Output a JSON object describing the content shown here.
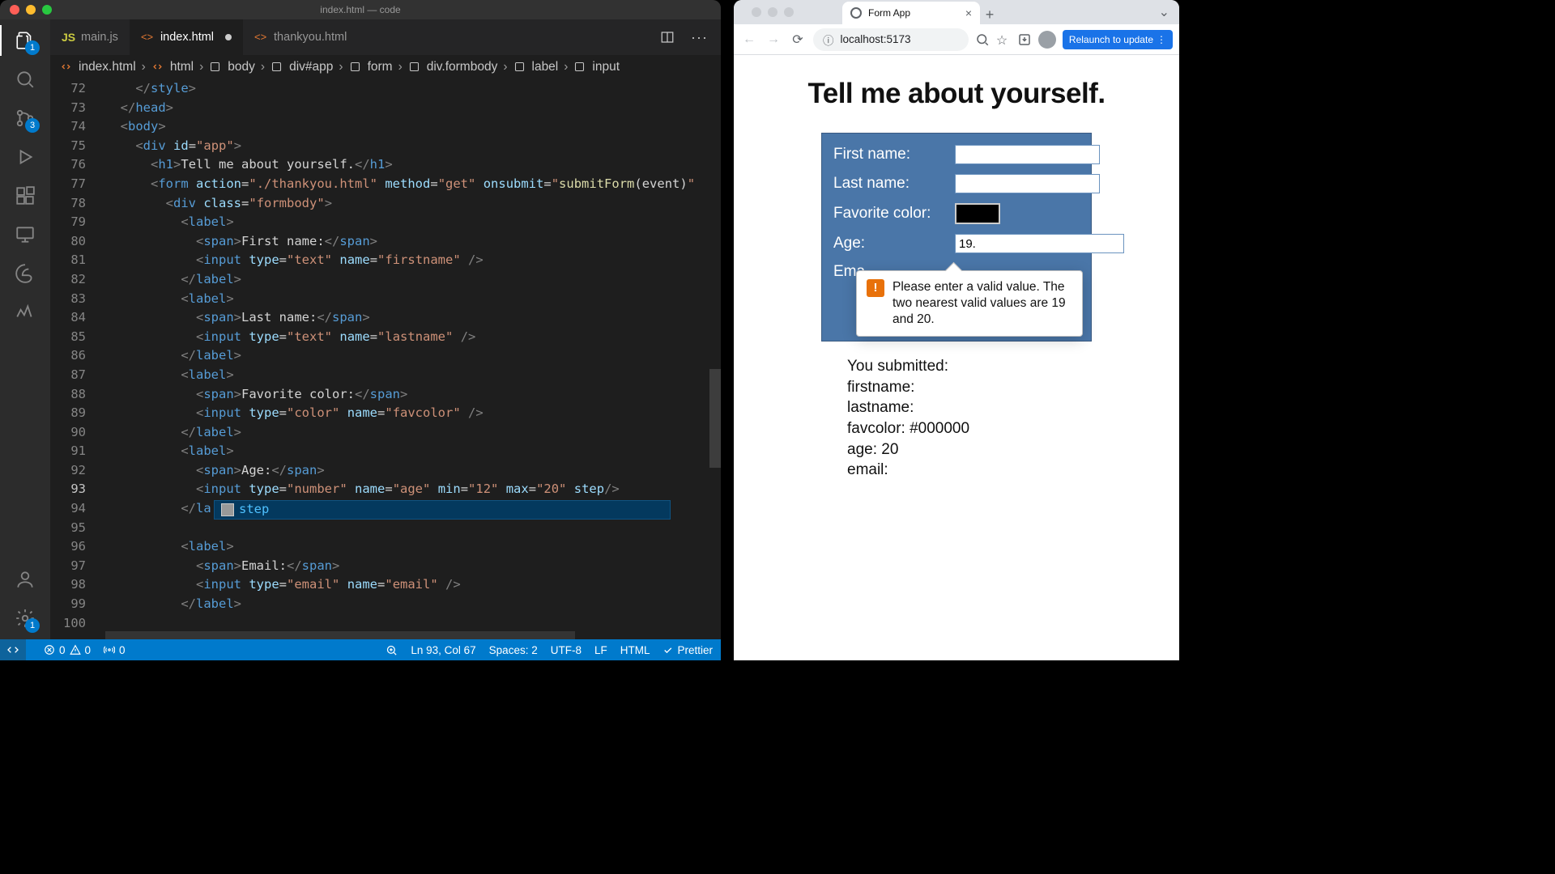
{
  "vscode": {
    "title": "index.html — code",
    "tabs": [
      {
        "label": "main.js"
      },
      {
        "label": "index.html",
        "active": true,
        "modified": true
      },
      {
        "label": "thankyou.html"
      }
    ],
    "breadcrumb": [
      "index.html",
      "html",
      "body",
      "div#app",
      "form",
      "div.formbody",
      "label",
      "input"
    ],
    "activity_badges": {
      "explorer": "1",
      "scm": "3",
      "settings": "1"
    },
    "autocomplete": {
      "text": "step"
    },
    "status": {
      "errors": "0",
      "warnings": "0",
      "ports": "0",
      "cursor": "Ln 93, Col 67",
      "spaces": "Spaces: 2",
      "encoding": "UTF-8",
      "eol": "LF",
      "language": "HTML",
      "formatter": "Prettier"
    },
    "code_lines": [
      {
        "n": 72,
        "html": "    <span class='s-brkt'>&lt;/</span><span class='s-tag'>style</span><span class='s-brkt'>&gt;</span>"
      },
      {
        "n": 73,
        "html": "  <span class='s-brkt'>&lt;/</span><span class='s-tag'>head</span><span class='s-brkt'>&gt;</span>"
      },
      {
        "n": 74,
        "html": "  <span class='s-brkt'>&lt;</span><span class='s-tag'>body</span><span class='s-brkt'>&gt;</span>"
      },
      {
        "n": 75,
        "html": "    <span class='s-brkt'>&lt;</span><span class='s-tag'>div</span> <span class='s-attr'>id</span>=<span class='s-str'>\"app\"</span><span class='s-brkt'>&gt;</span>"
      },
      {
        "n": 76,
        "html": "      <span class='s-brkt'>&lt;</span><span class='s-tag'>h1</span><span class='s-brkt'>&gt;</span>Tell me about yourself.<span class='s-brkt'>&lt;/</span><span class='s-tag'>h1</span><span class='s-brkt'>&gt;</span>"
      },
      {
        "n": 77,
        "html": "      <span class='s-brkt'>&lt;</span><span class='s-tag'>form</span> <span class='s-attr'>action</span>=<span class='s-str'>\"./thankyou.html\"</span> <span class='s-attr'>method</span>=<span class='s-str'>\"get\"</span> <span class='s-attr'>onsubmit</span>=<span class='s-str'>\"</span><span class='s-meth'>submitForm</span>(event)<span class='s-str'>\"</span>"
      },
      {
        "n": 78,
        "html": "        <span class='s-brkt'>&lt;</span><span class='s-tag'>div</span> <span class='s-attr'>class</span>=<span class='s-str'>\"formbody\"</span><span class='s-brkt'>&gt;</span>"
      },
      {
        "n": 79,
        "html": "          <span class='s-brkt'>&lt;</span><span class='s-tag'>label</span><span class='s-brkt'>&gt;</span>"
      },
      {
        "n": 80,
        "html": "            <span class='s-brkt'>&lt;</span><span class='s-tag'>span</span><span class='s-brkt'>&gt;</span>First name:<span class='s-brkt'>&lt;/</span><span class='s-tag'>span</span><span class='s-brkt'>&gt;</span>"
      },
      {
        "n": 81,
        "html": "            <span class='s-brkt'>&lt;</span><span class='s-tag'>input</span> <span class='s-attr'>type</span>=<span class='s-str'>\"text\"</span> <span class='s-attr'>name</span>=<span class='s-str'>\"firstname\"</span> <span class='s-brkt'>/&gt;</span>"
      },
      {
        "n": 82,
        "html": "          <span class='s-brkt'>&lt;/</span><span class='s-tag'>label</span><span class='s-brkt'>&gt;</span>"
      },
      {
        "n": 83,
        "html": "          <span class='s-brkt'>&lt;</span><span class='s-tag'>label</span><span class='s-brkt'>&gt;</span>"
      },
      {
        "n": 84,
        "html": "            <span class='s-brkt'>&lt;</span><span class='s-tag'>span</span><span class='s-brkt'>&gt;</span>Last name:<span class='s-brkt'>&lt;/</span><span class='s-tag'>span</span><span class='s-brkt'>&gt;</span>"
      },
      {
        "n": 85,
        "html": "            <span class='s-brkt'>&lt;</span><span class='s-tag'>input</span> <span class='s-attr'>type</span>=<span class='s-str'>\"text\"</span> <span class='s-attr'>name</span>=<span class='s-str'>\"lastname\"</span> <span class='s-brkt'>/&gt;</span>"
      },
      {
        "n": 86,
        "html": "          <span class='s-brkt'>&lt;/</span><span class='s-tag'>label</span><span class='s-brkt'>&gt;</span>"
      },
      {
        "n": 87,
        "html": "          <span class='s-brkt'>&lt;</span><span class='s-tag'>label</span><span class='s-brkt'>&gt;</span>"
      },
      {
        "n": 88,
        "html": "            <span class='s-brkt'>&lt;</span><span class='s-tag'>span</span><span class='s-brkt'>&gt;</span>Favorite color:<span class='s-brkt'>&lt;/</span><span class='s-tag'>span</span><span class='s-brkt'>&gt;</span>"
      },
      {
        "n": 89,
        "html": "            <span class='s-brkt'>&lt;</span><span class='s-tag'>input</span> <span class='s-attr'>type</span>=<span class='s-str'>\"color\"</span> <span class='s-attr'>name</span>=<span class='s-str'>\"favcolor\"</span> <span class='s-brkt'>/&gt;</span>"
      },
      {
        "n": 90,
        "html": "          <span class='s-brkt'>&lt;/</span><span class='s-tag'>label</span><span class='s-brkt'>&gt;</span>"
      },
      {
        "n": 91,
        "html": "          <span class='s-brkt'>&lt;</span><span class='s-tag'>label</span><span class='s-brkt'>&gt;</span>"
      },
      {
        "n": 92,
        "html": "            <span class='s-brkt'>&lt;</span><span class='s-tag'>span</span><span class='s-brkt'>&gt;</span>Age:<span class='s-brkt'>&lt;/</span><span class='s-tag'>span</span><span class='s-brkt'>&gt;</span>"
      },
      {
        "n": 93,
        "cur": true,
        "html": "            <span class='s-brkt'>&lt;</span><span class='s-tag'>input</span> <span class='s-attr'>type</span>=<span class='s-str'>\"number\"</span> <span class='s-attr'>name</span>=<span class='s-str'>\"age\"</span> <span class='s-attr'>min</span>=<span class='s-str'>\"12\"</span> <span class='s-attr'>max</span>=<span class='s-str'>\"20\"</span> <span class='s-attr'>step</span><span class='s-brkt'>/&gt;</span>"
      },
      {
        "n": 94,
        "html": "          <span class='s-brkt'>&lt;/</span><span class='s-tag'>la</span>"
      },
      {
        "n": 95,
        "html": ""
      },
      {
        "n": 96,
        "html": "          <span class='s-brkt'>&lt;</span><span class='s-tag'>label</span><span class='s-brkt'>&gt;</span>"
      },
      {
        "n": 97,
        "html": "            <span class='s-brkt'>&lt;</span><span class='s-tag'>span</span><span class='s-brkt'>&gt;</span>Email:<span class='s-brkt'>&lt;/</span><span class='s-tag'>span</span><span class='s-brkt'>&gt;</span>"
      },
      {
        "n": 98,
        "html": "            <span class='s-brkt'>&lt;</span><span class='s-tag'>input</span> <span class='s-attr'>type</span>=<span class='s-str'>\"email\"</span> <span class='s-attr'>name</span>=<span class='s-str'>\"email\"</span> <span class='s-brkt'>/&gt;</span>"
      },
      {
        "n": 99,
        "html": "          <span class='s-brkt'>&lt;/</span><span class='s-tag'>label</span><span class='s-brkt'>&gt;</span>"
      },
      {
        "n": 100,
        "html": ""
      }
    ]
  },
  "browser": {
    "tab_title": "Form App",
    "url": "localhost:5173",
    "relaunch": "Relaunch to update",
    "page": {
      "heading": "Tell me about yourself.",
      "labels": {
        "first": "First name:",
        "last": "Last name:",
        "color": "Favorite color:",
        "age": "Age:",
        "email": "Ema"
      },
      "age_value": "19.",
      "validation": "Please enter a valid value. The two nearest valid values are 19 and 20.",
      "results": {
        "submitted": "You submitted:",
        "first": "firstname:",
        "last": "lastname:",
        "color": "favcolor: #000000",
        "age": "age: 20",
        "email": "email:"
      }
    }
  }
}
